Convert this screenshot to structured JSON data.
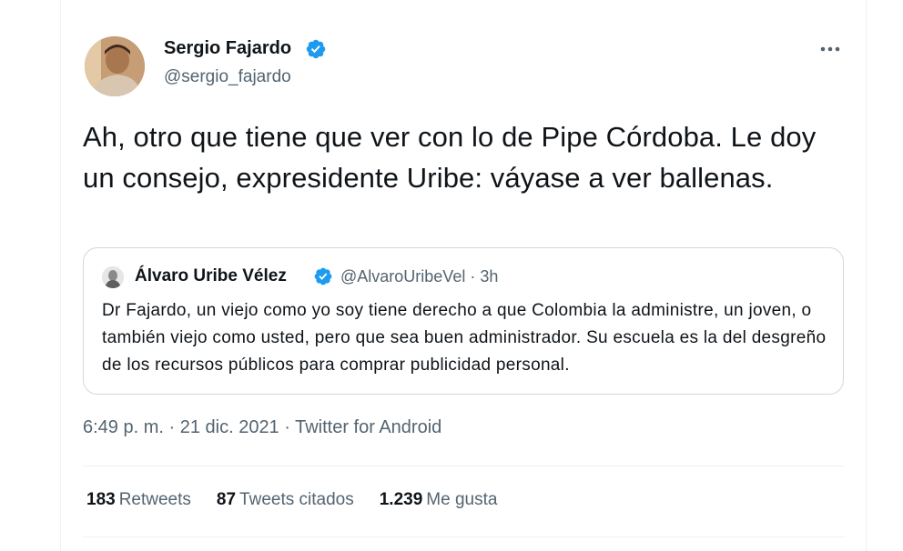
{
  "author": {
    "name": "Sergio Fajardo",
    "handle": "@sergio_fajardo"
  },
  "tweet": {
    "text": "Ah, otro que tiene que ver con lo de Pipe Córdoba. Le doy un consejo, expresidente Uribe: váyase a ver ballenas."
  },
  "quoted_tweet": {
    "name": "Álvaro Uribe Vélez",
    "handle": "@AlvaroUribeVel",
    "separator": "·",
    "time": "3h",
    "text": "Dr Fajardo, un viejo como yo soy tiene derecho a que Colombia la administre, un joven, o también viejo como usted, pero que sea buen administrador. Su escuela es la del desgreño de los recursos públicos para comprar publicidad personal."
  },
  "meta": {
    "timestamp": "6:49 p. m. · 21 dic. 2021 · Twitter for Android"
  },
  "stats": {
    "retweets_count": "183",
    "retweets_label": "Retweets",
    "quotes_count": "87",
    "quotes_label": "Tweets citados",
    "likes_count": "1.239",
    "likes_label": "Me gusta"
  },
  "icons": {
    "verified": "verified-badge-icon",
    "more": "more-options-icon"
  },
  "colors": {
    "verified_blue": "#1d9bf0",
    "text_primary": "#0f1419",
    "text_secondary": "#536471",
    "border": "#cfd9de"
  }
}
